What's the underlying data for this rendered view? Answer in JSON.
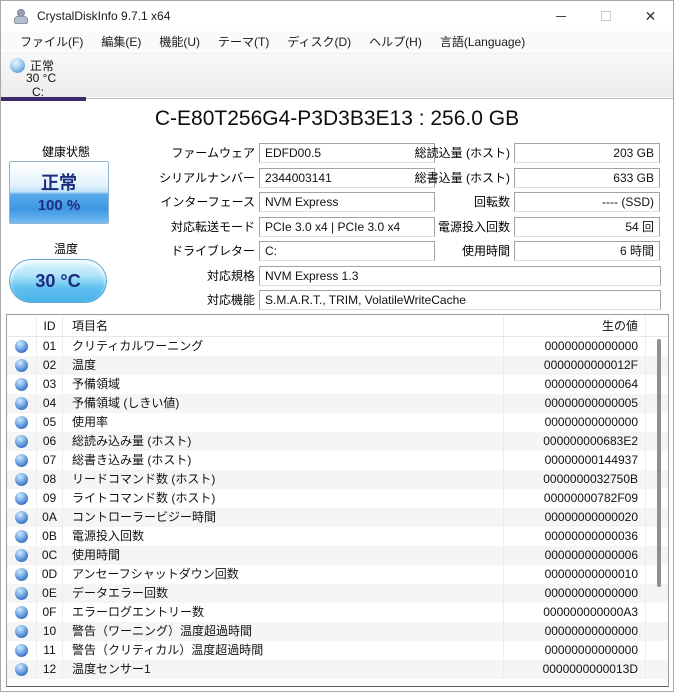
{
  "window": {
    "title": "CrystalDiskInfo 9.7.1 x64",
    "controls": {
      "minimize": "minimize",
      "maximize": "maximize",
      "close": "close"
    }
  },
  "menu": {
    "items": [
      {
        "key": "file",
        "label": "ファイル(F)"
      },
      {
        "key": "edit",
        "label": "編集(E)"
      },
      {
        "key": "function",
        "label": "機能(U)"
      },
      {
        "key": "theme",
        "label": "テーマ(T)"
      },
      {
        "key": "disk",
        "label": "ディスク(D)"
      },
      {
        "key": "help",
        "label": "ヘルプ(H)"
      },
      {
        "key": "language",
        "label": "言語(Language)"
      }
    ]
  },
  "drive_tab": {
    "status": "正常",
    "temperature": "30 °C",
    "letter": "C:"
  },
  "drive": {
    "title": "C-E80T256G4-P3D3B3E13 : 256.0 GB",
    "health": {
      "label": "健康状態",
      "status": "正常",
      "percent": "100 %"
    },
    "temperature": {
      "label": "温度",
      "value": "30 °C"
    },
    "fields_left": [
      {
        "label": "ファームウェア",
        "value": "EDFD00.5",
        "wide": false
      },
      {
        "label": "シリアルナンバー",
        "value": "2344003141",
        "wide": false
      },
      {
        "label": "インターフェース",
        "value": "NVM Express",
        "wide": false
      },
      {
        "label": "対応転送モード",
        "value": "PCIe 3.0 x4 | PCIe 3.0 x4",
        "wide": false
      },
      {
        "label": "ドライブレター",
        "value": "C:",
        "wide": false
      },
      {
        "label": "対応規格",
        "value": "NVM Express 1.3",
        "wide": true
      },
      {
        "label": "対応機能",
        "value": "S.M.A.R.T., TRIM, VolatileWriteCache",
        "wide": true
      }
    ],
    "fields_right": [
      {
        "label": "総読込量 (ホスト)",
        "value": "203 GB"
      },
      {
        "label": "総書込量 (ホスト)",
        "value": "633 GB"
      },
      {
        "label": "回転数",
        "value": "---- (SSD)"
      },
      {
        "label": "電源投入回数",
        "value": "54 回"
      },
      {
        "label": "使用時間",
        "value": "6 時間"
      }
    ]
  },
  "smart_table": {
    "headers": {
      "id": "ID",
      "name": "項目名",
      "raw": "生の値"
    },
    "status_icon": "status-good-icon",
    "rows": [
      {
        "id": "01",
        "name": "クリティカルワーニング",
        "raw": "00000000000000"
      },
      {
        "id": "02",
        "name": "温度",
        "raw": "0000000000012F"
      },
      {
        "id": "03",
        "name": "予備領域",
        "raw": "00000000000064"
      },
      {
        "id": "04",
        "name": "予備領域 (しきい値)",
        "raw": "00000000000005"
      },
      {
        "id": "05",
        "name": "使用率",
        "raw": "00000000000000"
      },
      {
        "id": "06",
        "name": "総読み込み量 (ホスト)",
        "raw": "000000000683E2"
      },
      {
        "id": "07",
        "name": "総書き込み量 (ホスト)",
        "raw": "00000000144937"
      },
      {
        "id": "08",
        "name": "リードコマンド数 (ホスト)",
        "raw": "0000000032750B"
      },
      {
        "id": "09",
        "name": "ライトコマンド数 (ホスト)",
        "raw": "00000000782F09"
      },
      {
        "id": "0A",
        "name": "コントローラービジー時間",
        "raw": "00000000000020"
      },
      {
        "id": "0B",
        "name": "電源投入回数",
        "raw": "00000000000036"
      },
      {
        "id": "0C",
        "name": "使用時間",
        "raw": "00000000000006"
      },
      {
        "id": "0D",
        "name": "アンセーフシャットダウン回数",
        "raw": "00000000000010"
      },
      {
        "id": "0E",
        "name": "データエラー回数",
        "raw": "00000000000000"
      },
      {
        "id": "0F",
        "name": "エラーログエントリー数",
        "raw": "000000000000A3"
      },
      {
        "id": "10",
        "name": "警告（ワーニング）温度超過時間",
        "raw": "00000000000000"
      },
      {
        "id": "11",
        "name": "警告（クリティカル）温度超過時間",
        "raw": "00000000000000"
      },
      {
        "id": "12",
        "name": "温度センサー1",
        "raw": "0000000000013D"
      }
    ]
  },
  "colors": {
    "accent_underline": "#3b2a68",
    "navy_text": "#1b2d7d",
    "status_dot": "#3e78c9",
    "row_stripe": "#f5f5f7"
  }
}
